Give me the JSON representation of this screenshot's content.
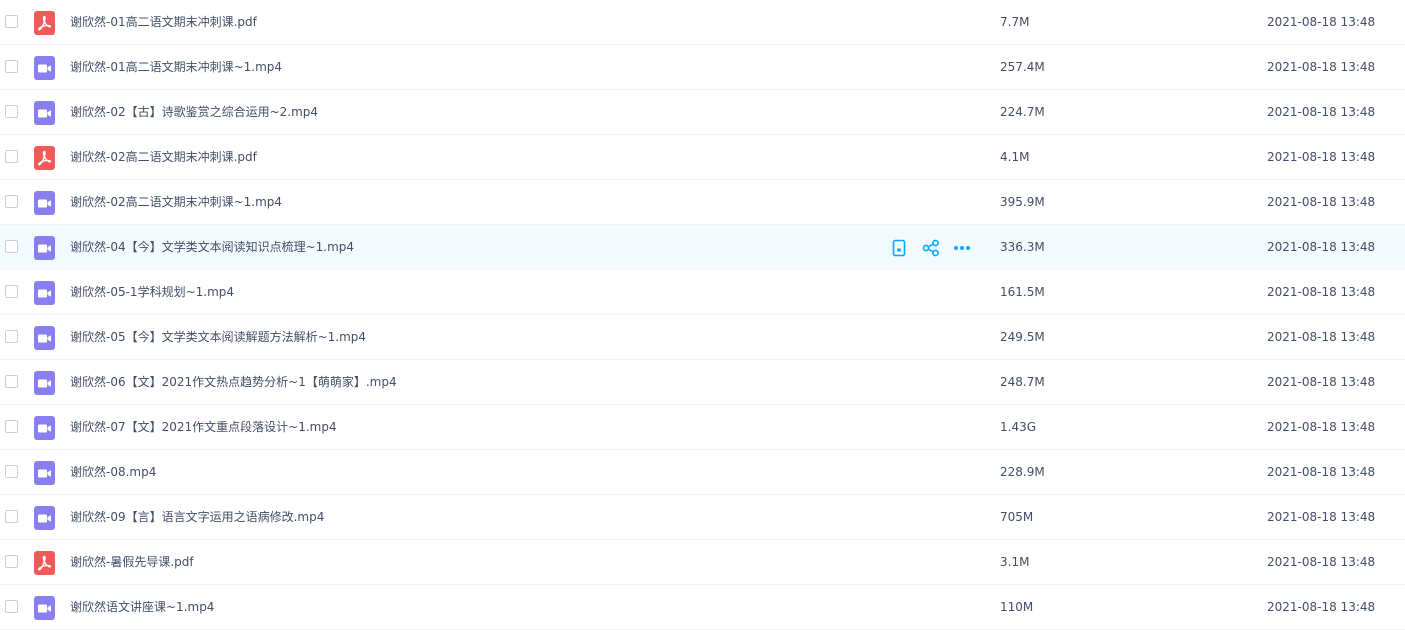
{
  "files": [
    {
      "name": "谢欣然-01高二语文期末冲刺课.pdf",
      "type": "pdf",
      "size": "7.7M",
      "date": "2021-08-18 13:48"
    },
    {
      "name": "谢欣然-01高二语文期末冲刺课~1.mp4",
      "type": "video",
      "size": "257.4M",
      "date": "2021-08-18 13:48"
    },
    {
      "name": "谢欣然-02【古】诗歌鉴赏之综合运用~2.mp4",
      "type": "video",
      "size": "224.7M",
      "date": "2021-08-18 13:48"
    },
    {
      "name": "谢欣然-02高二语文期末冲刺课.pdf",
      "type": "pdf",
      "size": "4.1M",
      "date": "2021-08-18 13:48"
    },
    {
      "name": "谢欣然-02高二语文期末冲刺课~1.mp4",
      "type": "video",
      "size": "395.9M",
      "date": "2021-08-18 13:48"
    },
    {
      "name": "谢欣然-04【今】文学类文本阅读知识点梳理~1.mp4",
      "type": "video",
      "size": "336.3M",
      "date": "2021-08-18 13:48",
      "hovered": true
    },
    {
      "name": "谢欣然-05-1学科规划~1.mp4",
      "type": "video",
      "size": "161.5M",
      "date": "2021-08-18 13:48"
    },
    {
      "name": "谢欣然-05【今】文学类文本阅读解题方法解析~1.mp4",
      "type": "video",
      "size": "249.5M",
      "date": "2021-08-18 13:48"
    },
    {
      "name": "谢欣然-06【文】2021作文热点趋势分析~1【萌萌家】.mp4",
      "type": "video",
      "size": "248.7M",
      "date": "2021-08-18 13:48"
    },
    {
      "name": "谢欣然-07【文】2021作文重点段落设计~1.mp4",
      "type": "video",
      "size": "1.43G",
      "date": "2021-08-18 13:48"
    },
    {
      "name": "谢欣然-08.mp4",
      "type": "video",
      "size": "228.9M",
      "date": "2021-08-18 13:48"
    },
    {
      "name": "谢欣然-09【言】语言文字运用之语病修改.mp4",
      "type": "video",
      "size": "705M",
      "date": "2021-08-18 13:48"
    },
    {
      "name": "谢欣然-暑假先导课.pdf",
      "type": "pdf",
      "size": "3.1M",
      "date": "2021-08-18 13:48"
    },
    {
      "name": "谢欣然语文讲座课~1.mp4",
      "type": "video",
      "size": "110M",
      "date": "2021-08-18 13:48"
    }
  ],
  "row_actions": [
    {
      "icon": "phone-icon",
      "label": "send to phone"
    },
    {
      "icon": "share-icon",
      "label": "share"
    },
    {
      "icon": "more-icon",
      "label": "more"
    }
  ],
  "colors": {
    "pdf_icon": "#f25a5a",
    "video_icon": "#8a7ff0",
    "action_accent": "#06a7ff",
    "hover_row": "#f4fbff"
  }
}
